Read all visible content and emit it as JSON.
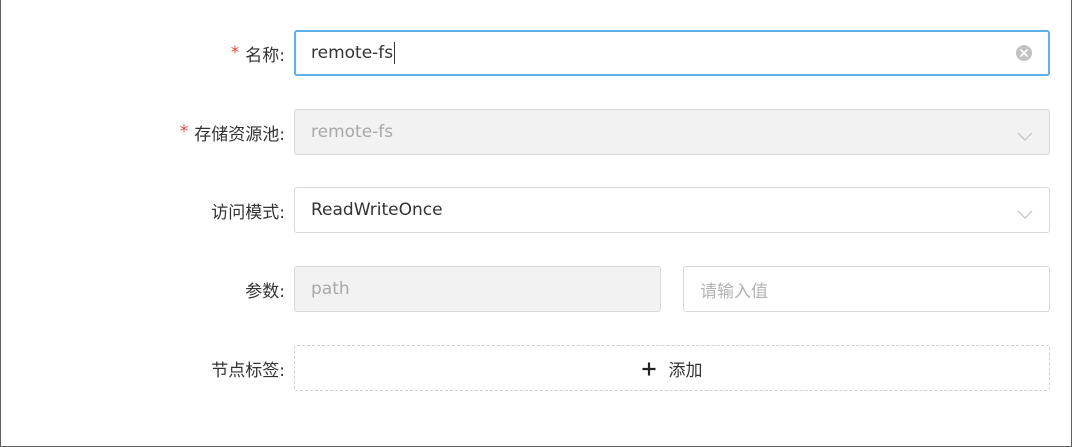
{
  "form": {
    "name": {
      "label": "名称:",
      "required_mark": "*",
      "value": "remote-fs",
      "clear_icon": "clear-circle-icon"
    },
    "storage_pool": {
      "label": "存储资源池:",
      "required_mark": "*",
      "value": "remote-fs",
      "disabled": true,
      "icon": "chevron-down-icon"
    },
    "access_mode": {
      "label": "访问模式:",
      "value": "ReadWriteOnce",
      "icon": "chevron-down-icon"
    },
    "params": {
      "label": "参数:",
      "key_placeholder": "path",
      "value_placeholder": "请输入值"
    },
    "node_labels": {
      "label": "节点标签:",
      "add_label": "添加",
      "icon": "plus-icon"
    }
  },
  "colors": {
    "required": "#e84a3c",
    "focus_border": "#5cb0e8",
    "disabled_bg": "#f2f2f2"
  }
}
